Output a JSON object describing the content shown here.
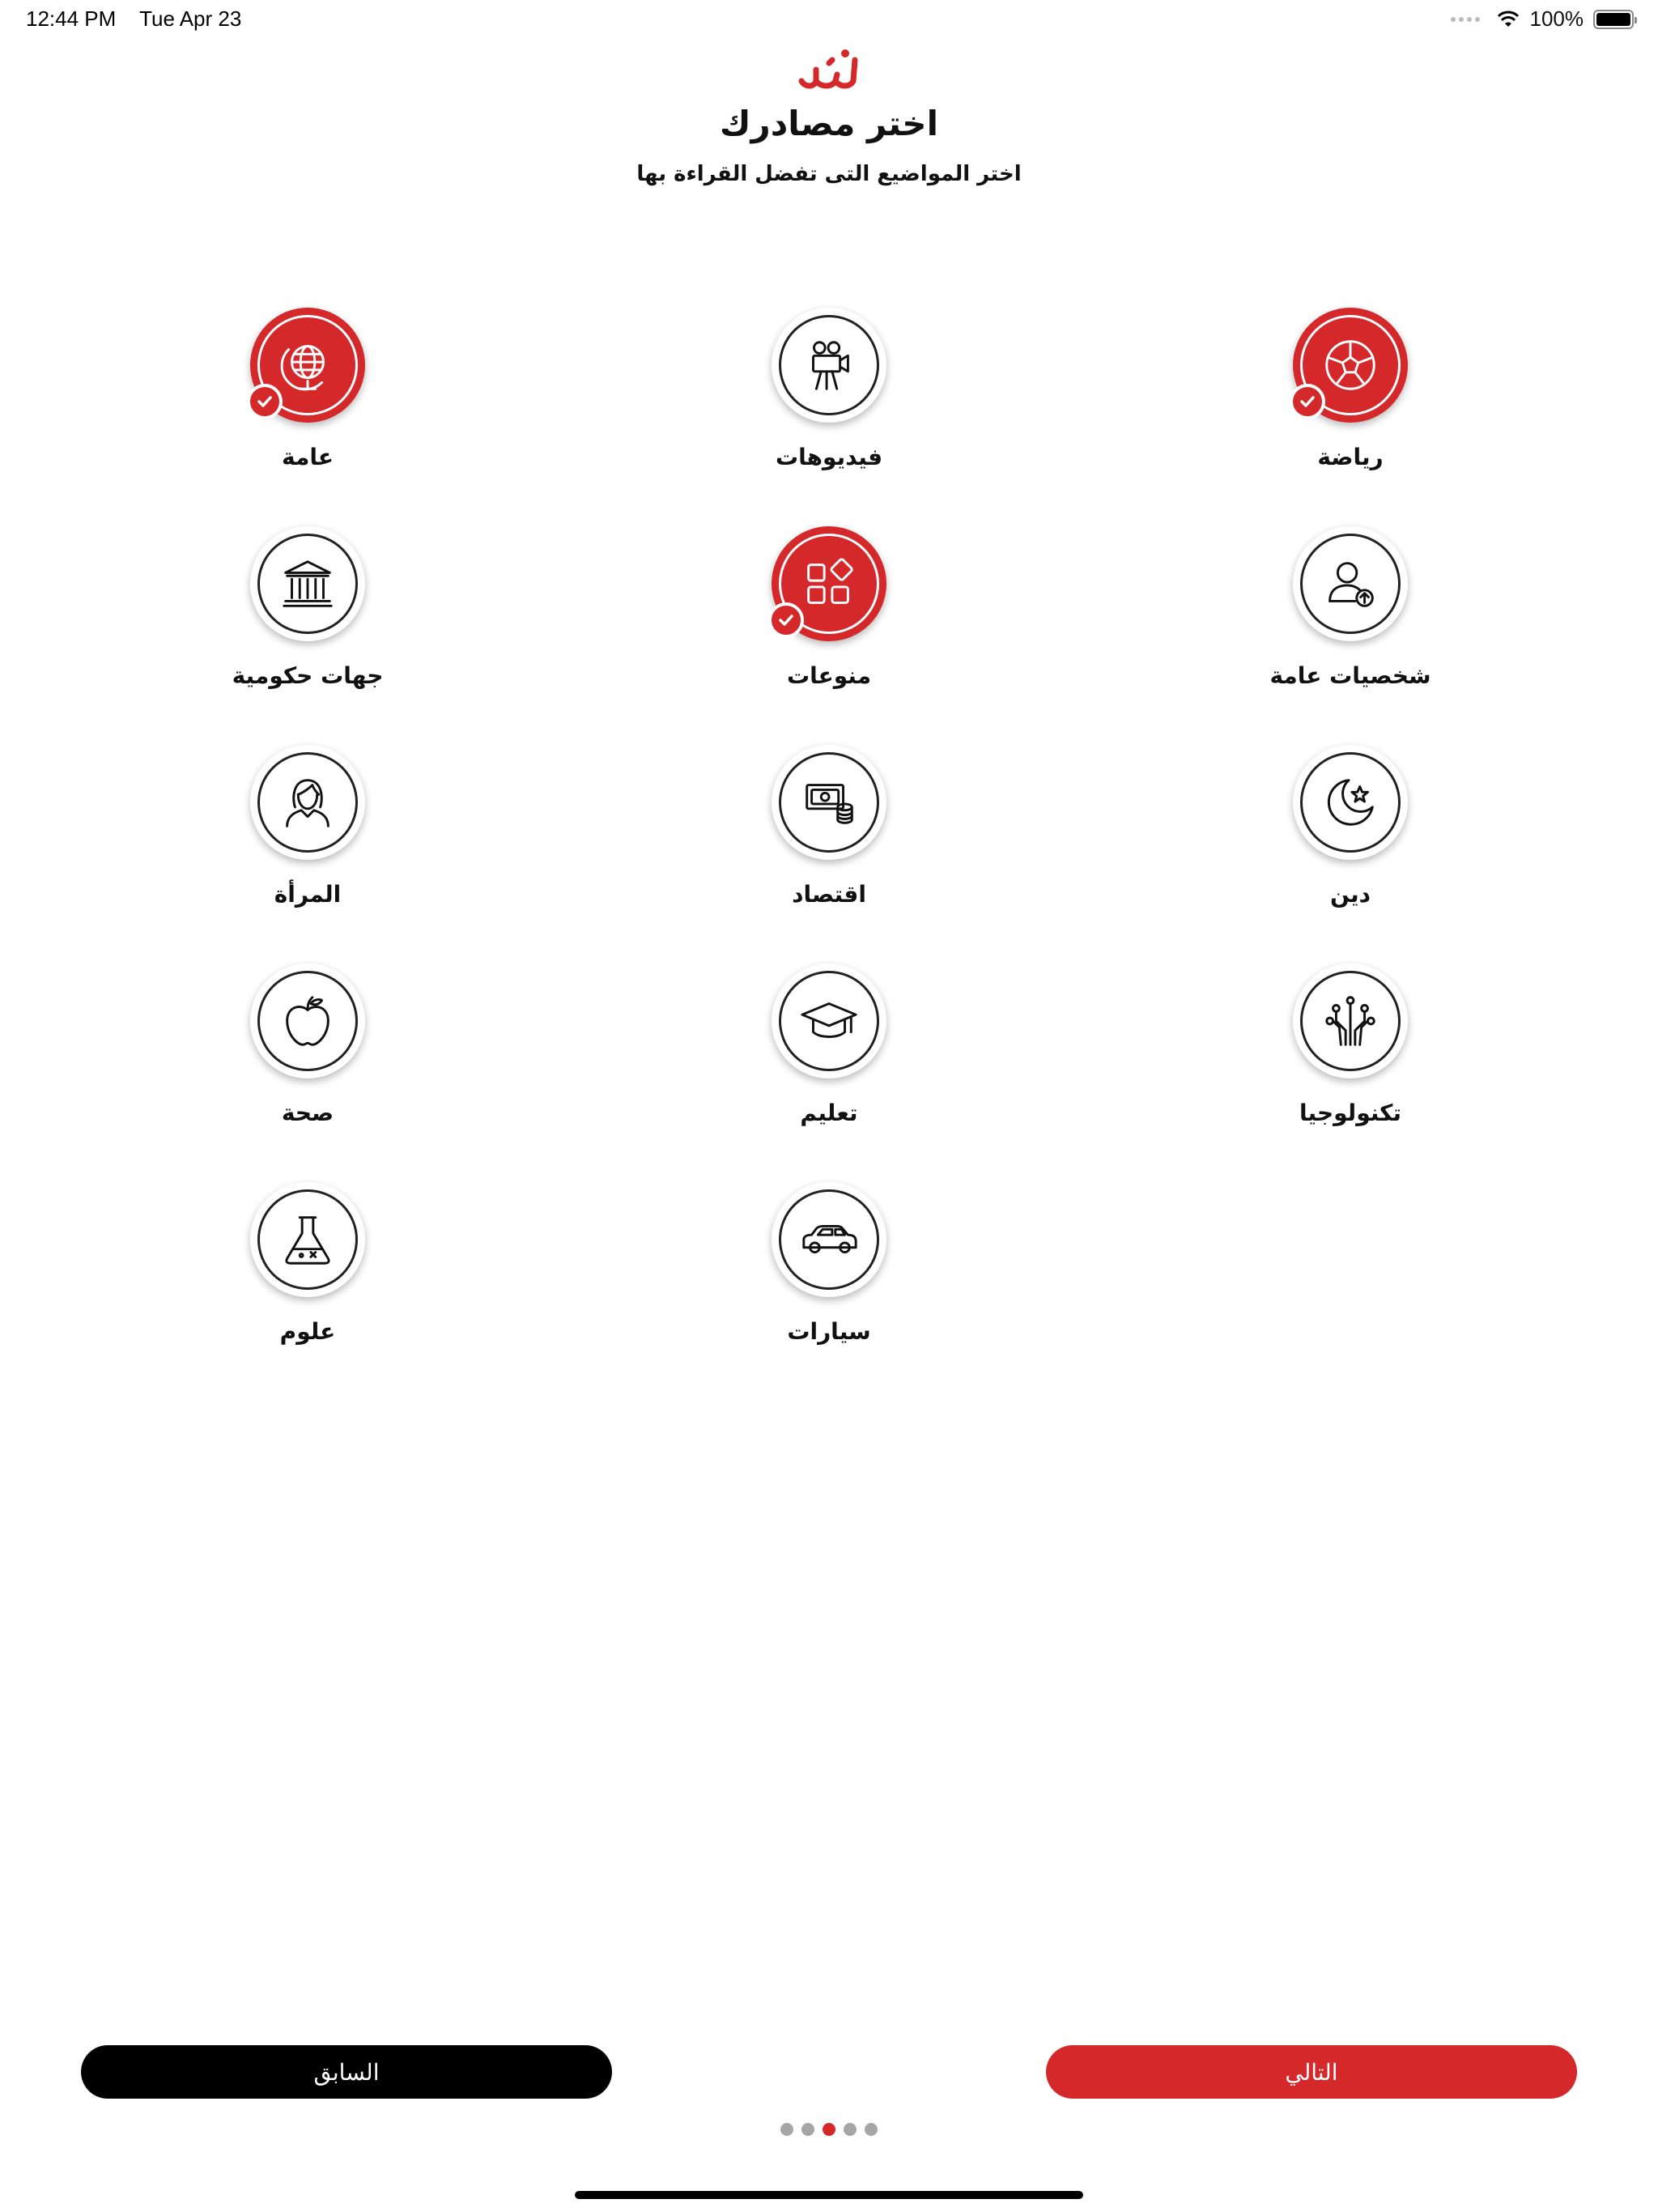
{
  "status_bar": {
    "time": "12:44 PM",
    "date": "Tue Apr 23",
    "battery": "100%"
  },
  "header": {
    "logo_icon": "nabaa-logo",
    "title": "اختر مصادرك",
    "subtitle": "اختر المواضيع التى تفضل القراءة بها"
  },
  "topics": [
    {
      "label": "رياضة",
      "icon": "football-icon",
      "selected": true
    },
    {
      "label": "فيديوهات",
      "icon": "video-camera-icon",
      "selected": false
    },
    {
      "label": "عامة",
      "icon": "globe-icon",
      "selected": true
    },
    {
      "label": "شخصيات عامة",
      "icon": "person-icon",
      "selected": false
    },
    {
      "label": "منوعات",
      "icon": "shapes-icon",
      "selected": true
    },
    {
      "label": "جهات حكومية",
      "icon": "government-building-icon",
      "selected": false
    },
    {
      "label": "دين",
      "icon": "crescent-star-icon",
      "selected": false
    },
    {
      "label": "اقتصاد",
      "icon": "money-icon",
      "selected": false
    },
    {
      "label": "المرأة",
      "icon": "woman-icon",
      "selected": false
    },
    {
      "label": "تكنولوجيا",
      "icon": "circuit-icon",
      "selected": false
    },
    {
      "label": "تعليم",
      "icon": "graduation-cap-icon",
      "selected": false
    },
    {
      "label": "صحة",
      "icon": "apple-icon",
      "selected": false
    },
    {
      "label": "سيارات",
      "icon": "car-icon",
      "selected": false
    },
    {
      "label": "علوم",
      "icon": "flask-icon",
      "selected": false
    }
  ],
  "buttons": {
    "next_label": "التالي",
    "prev_label": "السابق"
  },
  "pagination": {
    "total": 5,
    "current": 3
  },
  "colors": {
    "accent": "#d4282a",
    "dark": "#000000"
  }
}
